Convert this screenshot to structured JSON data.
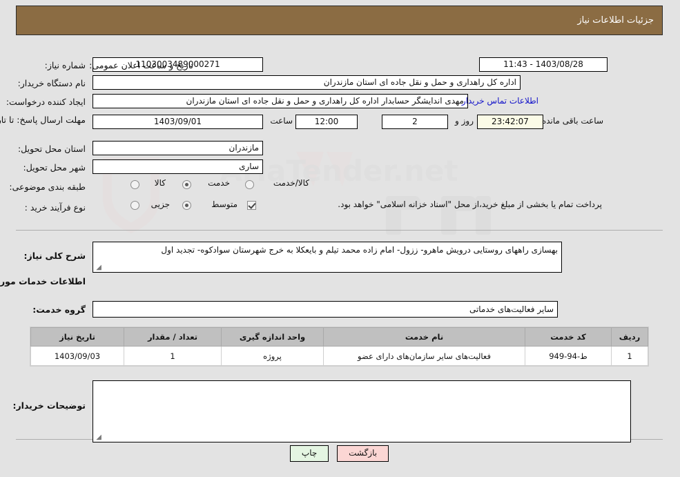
{
  "header": {
    "title": "جزئیات اطلاعات نیاز"
  },
  "form": {
    "need_number_label": "شماره نیاز:",
    "need_number_value": "1103003489000271",
    "public_announce_label": "تاریخ و ساعت اعلان عمومی:",
    "public_announce_value": "1403/08/28 - 11:43",
    "buyer_org_label": "نام دستگاه خریدار:",
    "buyer_org_value": "اداره کل راهداری و حمل و نقل جاده ای استان مازندران",
    "creator_label": "ایجاد کننده درخواست:",
    "creator_value": "مهدی اندایشگر حسابدار اداره کل راهداری و حمل و نقل جاده ای استان مازندران",
    "contact_link": "اطلاعات تماس خریدار",
    "deadline_label": "مهلت ارسال پاسخ: تا تاریخ:",
    "deadline_date": "1403/09/01",
    "deadline_hour_label": "ساعت",
    "deadline_hour": "12:00",
    "remaining_days": "2",
    "days_and_label": "روز و",
    "remaining_time": "23:42:07",
    "remaining_suffix": "ساعت باقی مانده",
    "province_label": "استان محل تحویل:",
    "province_value": "مازندران",
    "city_label": "شهر محل تحویل:",
    "city_value": "ساری",
    "category_label": "طبقه بندی موضوعی:",
    "category_options": [
      {
        "label": "کالا",
        "selected": false
      },
      {
        "label": "خدمت",
        "selected": true
      },
      {
        "label": "کالا/خدمت",
        "selected": false
      }
    ],
    "process_label": "نوع فرآیند خرید :",
    "process_options": [
      {
        "label": "جزیی",
        "selected": false
      },
      {
        "label": "متوسط",
        "selected": true
      }
    ],
    "treasury_checkbox_checked": true,
    "treasury_note": "پرداخت تمام یا بخشی از مبلغ خرید،از محل \"اسناد خزانه اسلامی\" خواهد بود."
  },
  "description": {
    "label": "شرح کلی نیاز:",
    "value": "بهسازی راههای روستایی درویش ماهرو- ززول- امام زاده محمد تیلم و بایعکلا به خرج شهرستان سوادکوه- تجدید اول"
  },
  "services_section": {
    "title": "اطلاعات خدمات مورد نیاز",
    "group_label": "گروه خدمت:",
    "group_value": "سایر فعالیت‌های خدماتی"
  },
  "table": {
    "columns": [
      "ردیف",
      "کد خدمت",
      "نام خدمت",
      "واحد اندازه گیری",
      "تعداد / مقدار",
      "تاریخ نیاز"
    ],
    "rows": [
      {
        "row": "1",
        "code": "ط-94-949",
        "name": "فعالیت‌های سایر سازمان‌های دارای عضو",
        "unit": "پروژه",
        "qty": "1",
        "date": "1403/09/03"
      }
    ]
  },
  "buyer_notes": {
    "label": "توضیحات خریدار:",
    "value": ""
  },
  "buttons": {
    "print": "چاپ",
    "back": "بازگشت"
  },
  "colors": {
    "header_bg": "#8b6c43",
    "page_bg": "#e3e3e3",
    "link": "#1313c9",
    "table_header_bg": "#c0c0c0",
    "print_btn_bg": "#e4f5e2",
    "back_btn_bg": "#fbd6d4",
    "timer_bg": "#fbfbe7"
  }
}
